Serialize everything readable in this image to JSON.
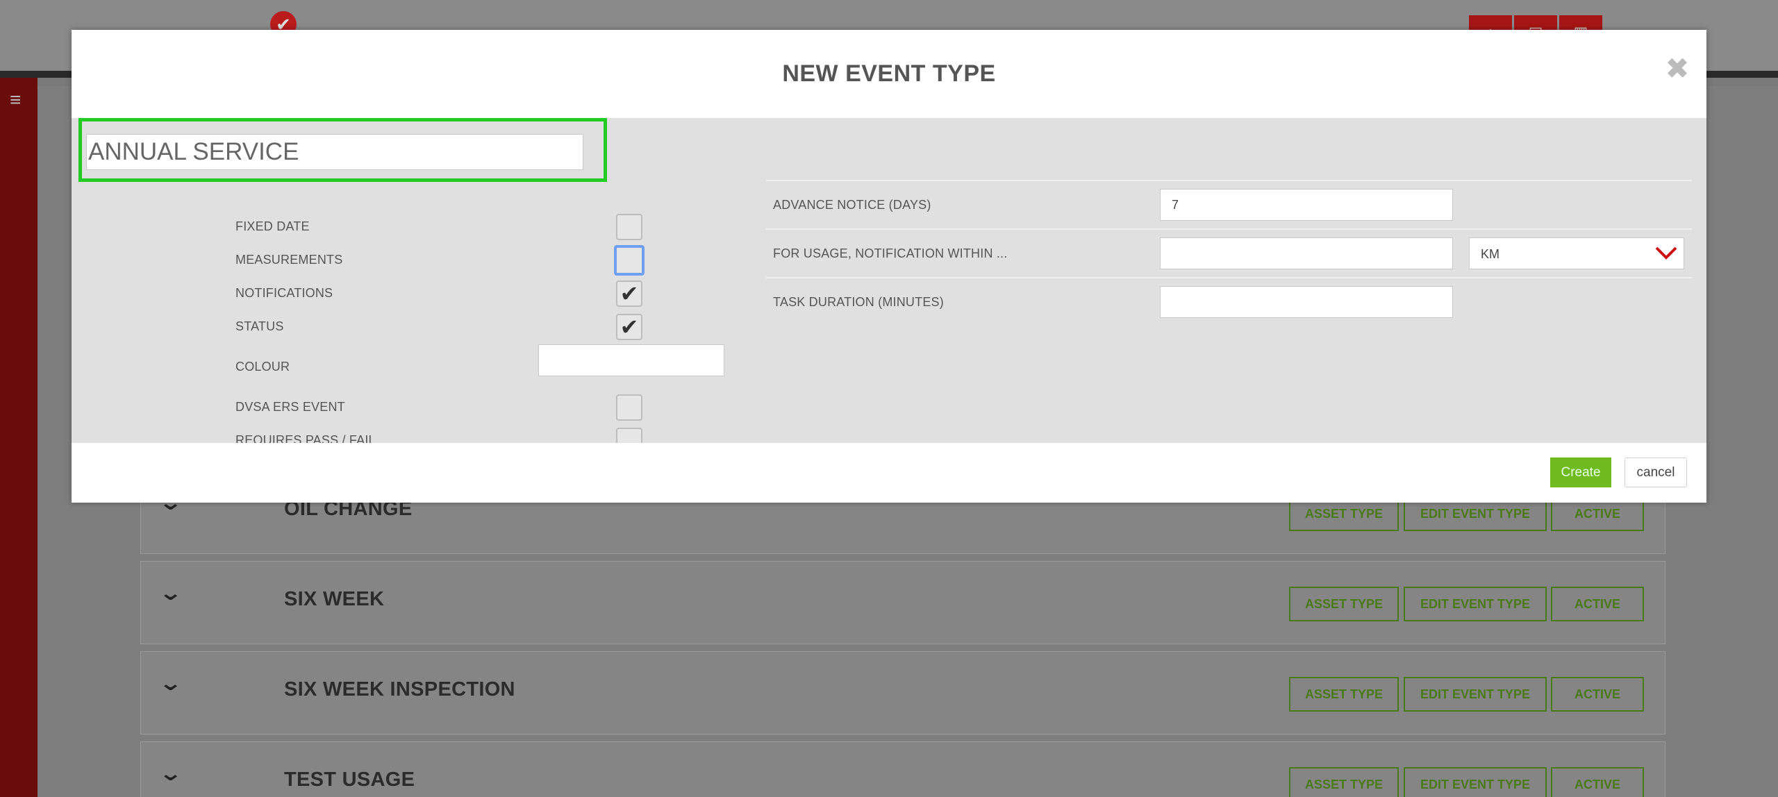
{
  "header": {
    "brand_icon": "check-circle-icon",
    "toolbar_icons": [
      "home-icon",
      "print-icon",
      "grid-icon"
    ],
    "menu_icon": "hamburger-icon"
  },
  "background_list": {
    "rows": [
      {
        "title": "OIL CHANGE",
        "asset_label": "ASSET TYPE",
        "edit_label": "EDIT EVENT TYPE",
        "status_label": "ACTIVE"
      },
      {
        "title": "SIX WEEK",
        "asset_label": "ASSET TYPE",
        "edit_label": "EDIT EVENT TYPE",
        "status_label": "ACTIVE"
      },
      {
        "title": "SIX WEEK INSPECTION",
        "asset_label": "ASSET TYPE",
        "edit_label": "EDIT EVENT TYPE",
        "status_label": "ACTIVE"
      },
      {
        "title": "TEST USAGE",
        "asset_label": "ASSET TYPE",
        "edit_label": "EDIT EVENT TYPE",
        "status_label": "ACTIVE"
      }
    ],
    "button_color": "#4a7a18"
  },
  "modal": {
    "title": "NEW EVENT TYPE",
    "close_symbol": "✖",
    "name_value": "ANNUAL SERVICE",
    "highlight_color": "#22cc22",
    "options": {
      "fixed_date": {
        "label": "FIXED DATE",
        "checked": false
      },
      "measurements": {
        "label": "MEASUREMENTS",
        "checked": false
      },
      "notifications": {
        "label": "NOTIFICATIONS",
        "checked": true
      },
      "status": {
        "label": "STATUS",
        "checked": true
      },
      "colour": {
        "label": "COLOUR",
        "value": ""
      },
      "dvsa": {
        "label": "DVSA ERS EVENT",
        "checked": false
      },
      "pass_fail": {
        "label": "REQUIRES PASS / FAIL",
        "checked": false
      }
    },
    "settings": {
      "advance_notice": {
        "label": "ADVANCE NOTICE (DAYS)",
        "value": "7"
      },
      "usage_notification": {
        "label": "FOR USAGE, NOTIFICATION WITHIN ...",
        "value": "",
        "unit": "KM"
      },
      "task_duration": {
        "label": "TASK DURATION (MINUTES)",
        "value": ""
      }
    },
    "footer": {
      "create_label": "Create",
      "cancel_label": "cancel",
      "create_color": "#6fbb1f"
    }
  }
}
